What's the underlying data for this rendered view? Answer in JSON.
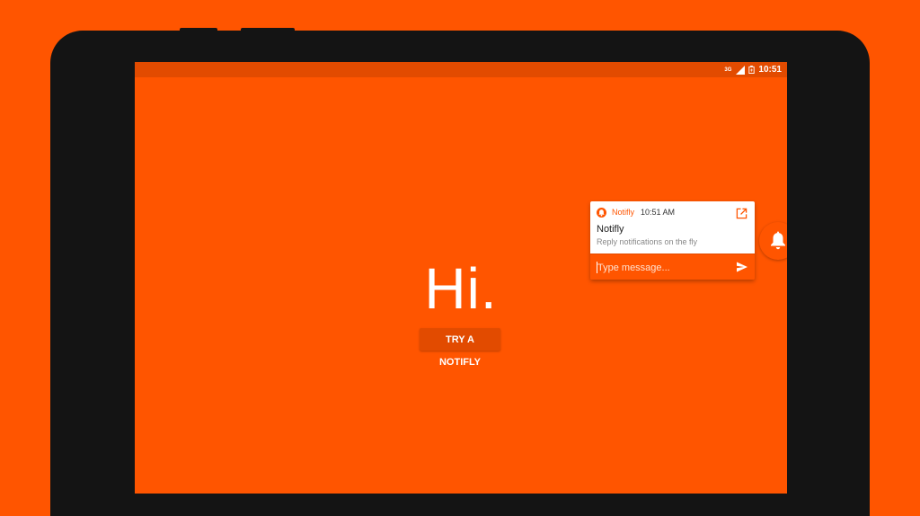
{
  "status_bar": {
    "network": "3G",
    "time": "10:51"
  },
  "main": {
    "greeting": "Hi.",
    "try_button_label": "TRY A NOTIFLY"
  },
  "notification": {
    "app_name": "Notifly",
    "time": "10:51 AM",
    "title": "Notifly",
    "text": "Reply notifications on the fly",
    "reply_placeholder": "Type message..."
  },
  "icons": {
    "app": "notifly-bell-icon",
    "open": "open-external-icon",
    "send": "send-icon",
    "floating": "bell-icon",
    "signal": "signal-icon",
    "battery": "battery-charging-icon"
  },
  "colors": {
    "primary": "#FF5500",
    "primary_dark": "#E24B00",
    "device_frame": "#141414",
    "surface": "#FFFFFF"
  }
}
